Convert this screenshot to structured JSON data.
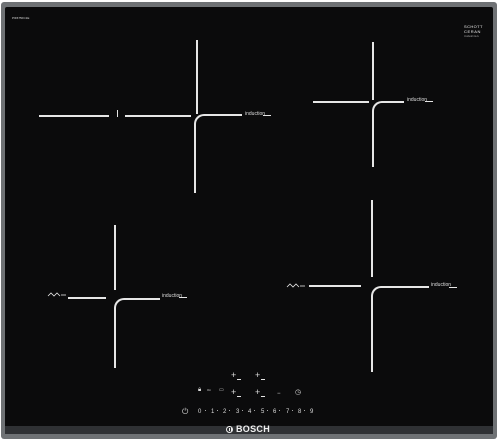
{
  "labels": {
    "model_number": "PIF675FC1E",
    "induction": "induction",
    "brand": "BOSCH"
  },
  "schott": {
    "line1": "SCHOTT",
    "line2": "CERAN",
    "tagline": "induction"
  },
  "controls": {
    "power_symbol": "⏻",
    "lock_symbol": "🔒︎",
    "timer_symbol": "◷",
    "on_label": "On",
    "slider_values": [
      "0",
      "1",
      "2",
      "3",
      "4",
      "5",
      "6",
      "7",
      "8",
      "9"
    ]
  },
  "colors": {
    "frame": "#6f7275",
    "glass": "#0b0b0c",
    "markings": "#e6e6e6"
  }
}
